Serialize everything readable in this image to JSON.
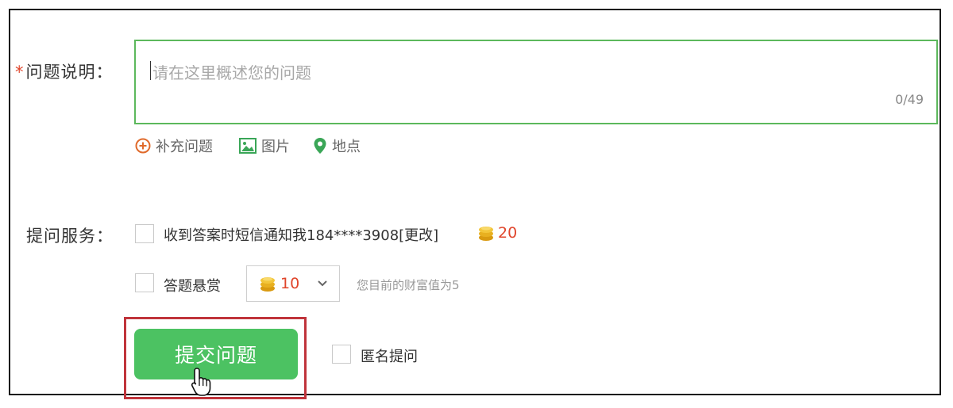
{
  "question": {
    "required_mark": "*",
    "label": "问题说明：",
    "placeholder": "请在这里概述您的问题",
    "counter": "0/49"
  },
  "toolbar": {
    "supplement_label": "补充问题",
    "image_label": "图片",
    "location_label": "地点"
  },
  "service": {
    "label": "提问服务：",
    "sms_option": "收到答案时短信通知我184****3908[更改]",
    "sms_cost": "20",
    "bounty_option": "答题悬赏",
    "bounty_value": "10",
    "wealth_hint": "您目前的财富值为5"
  },
  "actions": {
    "submit_label": "提交问题",
    "anonymous_label": "匿名提问"
  },
  "colors": {
    "accent_green": "#4cc262",
    "required_red": "#e0452b",
    "highlight_red": "#c0343b",
    "coin_gold": "#e8b020"
  }
}
